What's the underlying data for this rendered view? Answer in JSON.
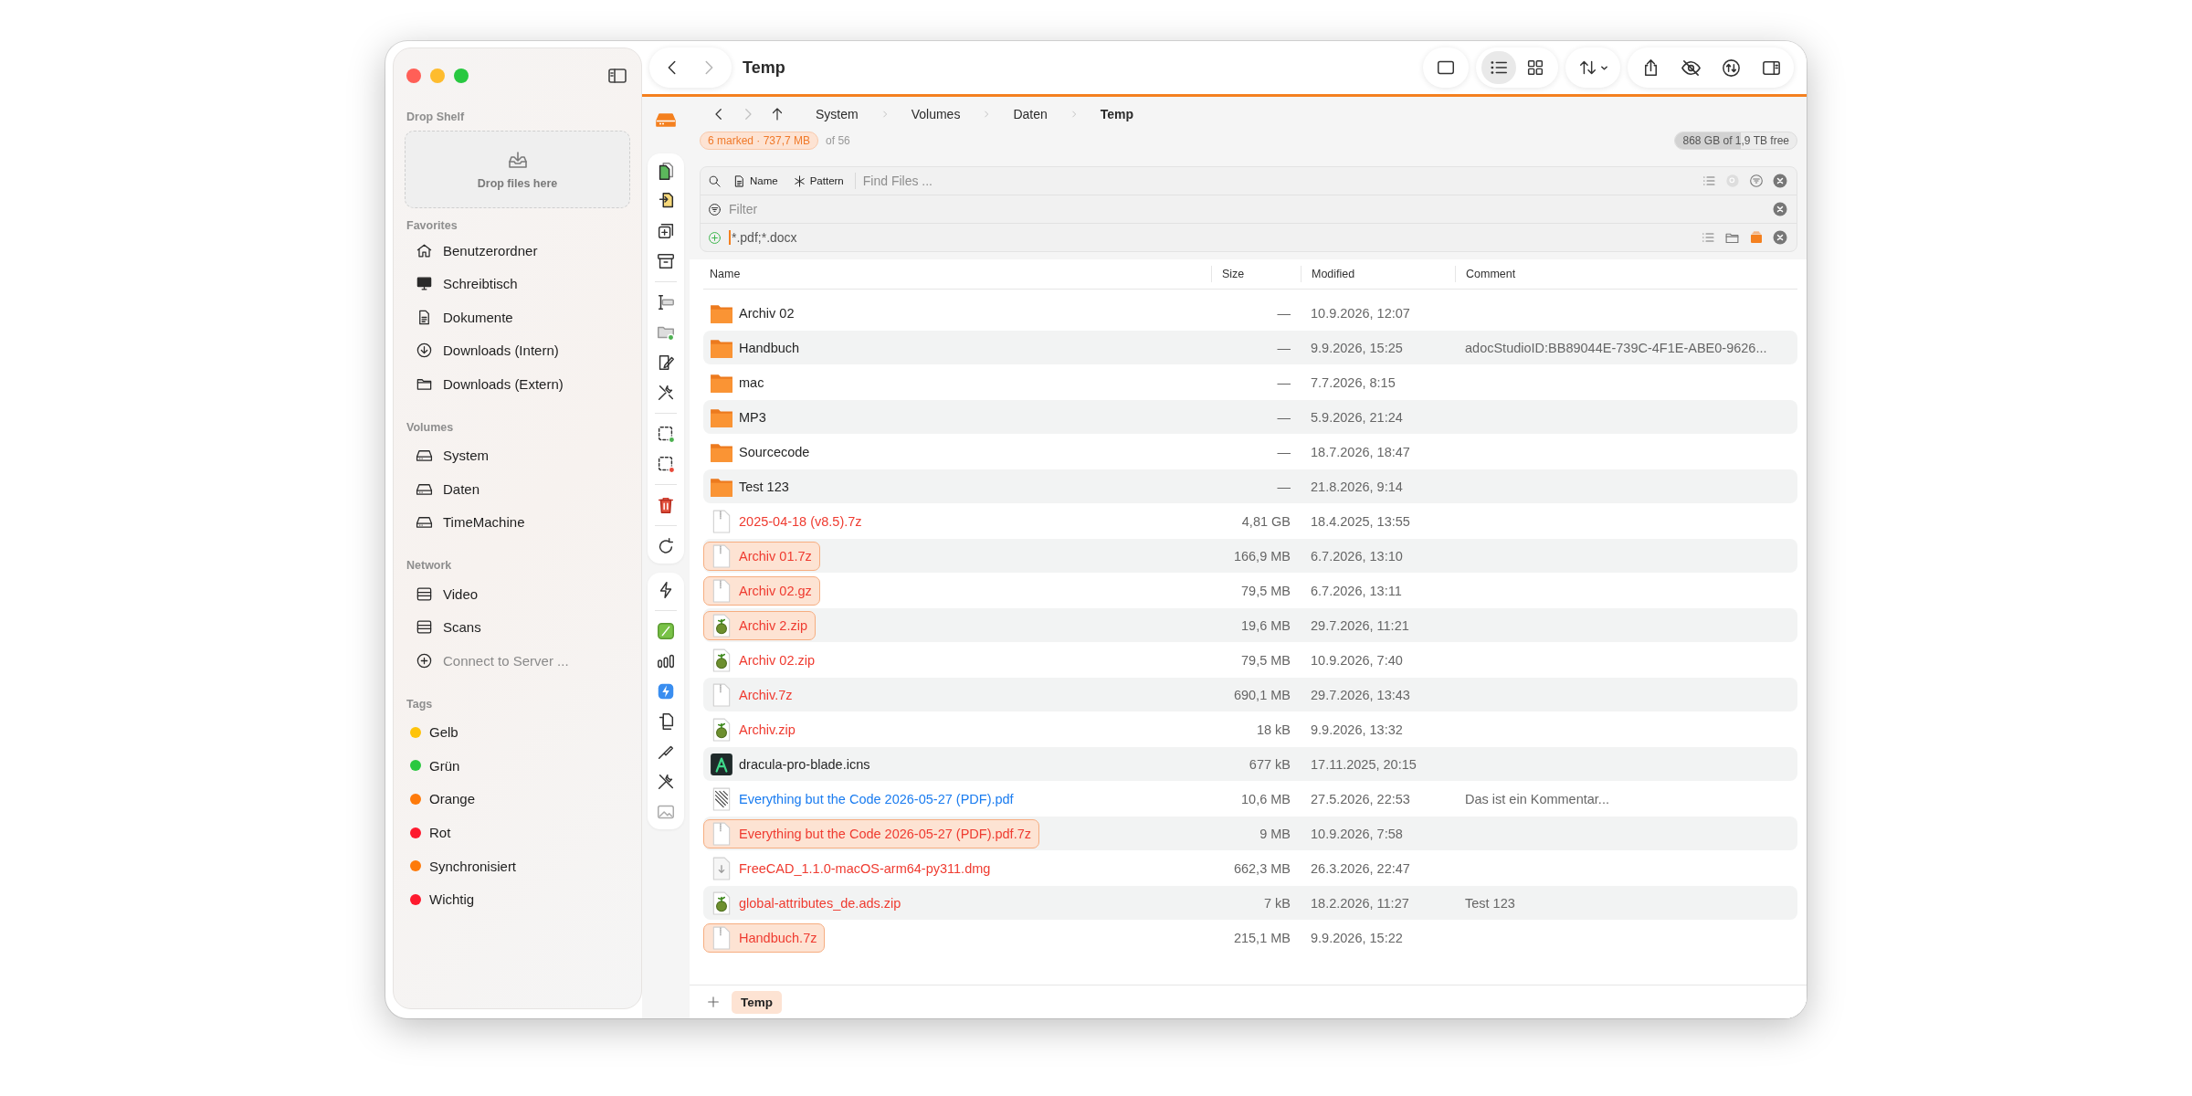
{
  "window": {
    "title": "Temp"
  },
  "sidebar": {
    "drop_shelf": {
      "title": "Drop Shelf",
      "hint": "Drop files here"
    },
    "sections": [
      {
        "title": "Favorites",
        "items": [
          {
            "label": "Benutzerordner",
            "kind": "home",
            "disabled": false
          },
          {
            "label": "Schreibtisch",
            "kind": "desktop",
            "disabled": false
          },
          {
            "label": "Dokumente",
            "kind": "document",
            "disabled": false
          },
          {
            "label": "Downloads (Intern)",
            "kind": "download",
            "disabled": false
          },
          {
            "label": "Downloads (Extern)",
            "kind": "folder",
            "disabled": false
          }
        ]
      },
      {
        "title": "Volumes",
        "items": [
          {
            "label": "System",
            "kind": "drive",
            "disabled": false
          },
          {
            "label": "Daten",
            "kind": "drive",
            "disabled": false
          },
          {
            "label": "TimeMachine",
            "kind": "drive",
            "disabled": false
          }
        ]
      },
      {
        "title": "Network",
        "items": [
          {
            "label": "Video",
            "kind": "server",
            "disabled": false
          },
          {
            "label": "Scans",
            "kind": "server",
            "disabled": false
          },
          {
            "label": "Connect to Server ...",
            "kind": "add",
            "disabled": true
          }
        ]
      }
    ],
    "tags": {
      "title": "Tags",
      "items": [
        {
          "label": "Gelb",
          "color": "#fec309"
        },
        {
          "label": "Grün",
          "color": "#2ac840"
        },
        {
          "label": "Orange",
          "color": "#fe7a0a"
        },
        {
          "label": "Rot",
          "color": "#fe1a2e"
        },
        {
          "label": "Synchronisiert",
          "color": "#fe7a0a"
        },
        {
          "label": "Wichtig",
          "color": "#fe1a2e"
        }
      ]
    }
  },
  "toolbar": {
    "back_disabled": false,
    "forward_disabled": true,
    "view_modes": [
      {
        "kind": "single",
        "selected": false
      },
      {
        "kind": "list",
        "selected": true
      },
      {
        "kind": "grid",
        "selected": false
      }
    ]
  },
  "path": {
    "back_disabled": false,
    "forward_disabled": true,
    "crumbs": [
      {
        "label": "System",
        "current": false
      },
      {
        "label": "Volumes",
        "current": false
      },
      {
        "label": "Daten",
        "current": false
      },
      {
        "label": "Temp",
        "current": true
      }
    ]
  },
  "selection": {
    "summary": "6 marked · 737,7 MB",
    "total": "of 56"
  },
  "free_space": {
    "text": "868 GB of 1,9 TB free",
    "level": 0.54
  },
  "search": {
    "buttons": [
      "Name",
      "Pattern"
    ],
    "placeholder": "Find Files ..."
  },
  "filter": {
    "placeholder": "Filter"
  },
  "pattern": {
    "value": "*.pdf;*.docx"
  },
  "table": {
    "columns": [
      "Name",
      "Size",
      "Modified",
      "Comment"
    ],
    "rows": [
      {
        "kind": "folder",
        "name": "Archiv 02",
        "size": "—",
        "modified": "10.9.2026, 12:07",
        "color": "#262626",
        "marked": false
      },
      {
        "kind": "folder",
        "name": "Handbuch",
        "size": "—",
        "modified": "9.9.2026, 15:25",
        "comment": "adocStudioID:BB89044E-739C-4F1E-ABE0-9626...",
        "color": "#262626",
        "marked": false
      },
      {
        "kind": "folder",
        "name": "mac",
        "size": "—",
        "modified": "7.7.2026, 8:15",
        "color": "#262626",
        "marked": false
      },
      {
        "kind": "folder",
        "name": "MP3",
        "size": "—",
        "modified": "5.9.2026, 21:24",
        "color": "#262626",
        "marked": false
      },
      {
        "kind": "folder",
        "name": "Sourcecode",
        "size": "—",
        "modified": "18.7.2026, 18:47",
        "color": "#262626",
        "marked": false
      },
      {
        "kind": "folder",
        "name": "Test 123",
        "size": "—",
        "modified": "21.8.2026, 9:14",
        "color": "#262626",
        "marked": false
      },
      {
        "kind": "archive",
        "name": "2025-04-18 (v8.5).7z",
        "size": "4,81 GB",
        "modified": "18.4.2025, 13:55",
        "color": "#ef3b30",
        "marked": false
      },
      {
        "kind": "archive",
        "name": "Archiv 01.7z",
        "size": "166,9 MB",
        "modified": "6.7.2026, 13:10",
        "color": "#ef3b30",
        "marked": true
      },
      {
        "kind": "archive",
        "name": "Archiv 02.gz",
        "size": "79,5 MB",
        "modified": "6.7.2026, 13:11",
        "color": "#ef3b30",
        "marked": true
      },
      {
        "kind": "zip",
        "name": "Archiv 2.zip",
        "size": "19,6 MB",
        "modified": "29.7.2026, 11:21",
        "color": "#ef3b30",
        "marked": true
      },
      {
        "kind": "zip",
        "name": "Archiv 02.zip",
        "size": "79,5 MB",
        "modified": "10.9.2026, 7:40",
        "color": "#ef3b30",
        "marked": false
      },
      {
        "kind": "archive",
        "name": "Archiv.7z",
        "size": "690,1 MB",
        "modified": "29.7.2026, 13:43",
        "color": "#ef3b30",
        "marked": false
      },
      {
        "kind": "zip",
        "name": "Archiv.zip",
        "size": "18 kB",
        "modified": "9.9.2026, 13:32",
        "color": "#ef3b30",
        "marked": false
      },
      {
        "kind": "icns",
        "name": "dracula-pro-blade.icns",
        "size": "677 kB",
        "modified": "17.11.2025, 20:15",
        "color": "#262626",
        "marked": false
      },
      {
        "kind": "pdf",
        "name": "Everything but the Code 2026-05-27 (PDF).pdf",
        "size": "10,6 MB",
        "modified": "27.5.2026, 22:53",
        "comment": "Das ist ein Kommentar...",
        "color": "#1a7cf0",
        "marked": false
      },
      {
        "kind": "archive",
        "name": "Everything but the Code 2026-05-27 (PDF).pdf.7z",
        "size": "9 MB",
        "modified": "10.9.2026, 7:58",
        "color": "#ef3b30",
        "marked": true
      },
      {
        "kind": "dmg",
        "name": "FreeCAD_1.1.0-macOS-arm64-py311.dmg",
        "size": "662,3 MB",
        "modified": "26.3.2026, 22:47",
        "color": "#ef3b30",
        "marked": false
      },
      {
        "kind": "zip",
        "name": "global-attributes_de.ads.zip",
        "size": "7 kB",
        "modified": "18.2.2026, 11:27",
        "comment": "Test 123",
        "color": "#ef3b30",
        "marked": false
      },
      {
        "kind": "archive",
        "name": "Handbuch.7z",
        "size": "215,1 MB",
        "modified": "9.9.2026, 15:22",
        "color": "#ef3b30",
        "marked": true
      }
    ]
  },
  "tabs": [
    {
      "label": "Temp",
      "selected": true
    }
  ]
}
